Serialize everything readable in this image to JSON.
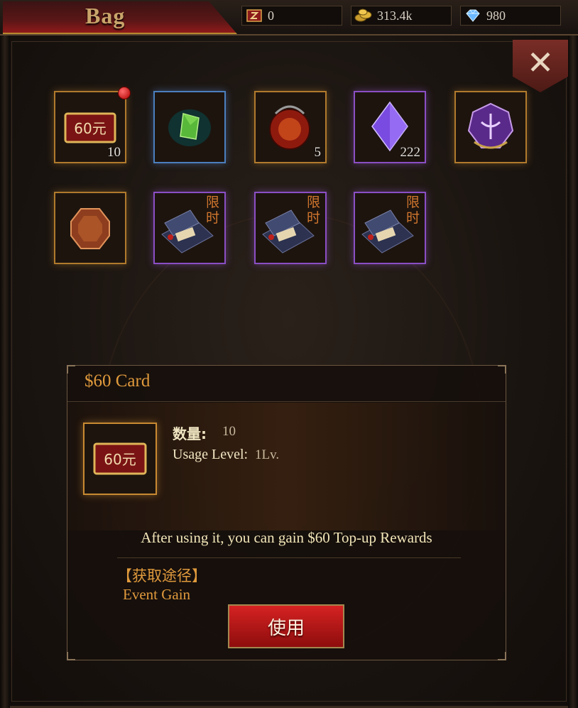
{
  "header": {
    "title": "Bag",
    "resources": [
      {
        "icon": "ticket-icon",
        "value": "0"
      },
      {
        "icon": "gold-coins-icon",
        "value": "313.4k"
      },
      {
        "icon": "diamond-icon",
        "value": "980"
      }
    ],
    "close_label": "✕"
  },
  "inventory": {
    "items": [
      {
        "name": "60-card",
        "icon": "card-60-icon",
        "card_text": "60元",
        "count": "10",
        "rarity": "orange",
        "has_alert": true
      },
      {
        "name": "green-gem",
        "icon": "green-gem-icon",
        "count": "",
        "rarity": "blue"
      },
      {
        "name": "red-amulet",
        "icon": "red-amulet-icon",
        "count": "5",
        "rarity": "orange"
      },
      {
        "name": "purple-crystal",
        "icon": "purple-crystal-icon",
        "count": "222",
        "rarity": "purple"
      },
      {
        "name": "purple-emblem",
        "icon": "purple-emblem-icon",
        "count": "",
        "rarity": "orange"
      },
      {
        "name": "orange-gem",
        "icon": "orange-gem-icon",
        "count": "",
        "rarity": "orange"
      },
      {
        "name": "limited-chest-1",
        "icon": "limited-chest-icon",
        "limited_label": "限时",
        "rarity": "purple"
      },
      {
        "name": "limited-chest-2",
        "icon": "limited-chest-icon",
        "limited_label": "限时",
        "rarity": "purple"
      },
      {
        "name": "limited-chest-3",
        "icon": "limited-chest-icon",
        "limited_label": "限时",
        "rarity": "purple"
      }
    ]
  },
  "detail": {
    "title": "$60 Card",
    "card_text": "60元",
    "quantity_label": "数量:",
    "quantity_value": "10",
    "level_label": "Usage Level:",
    "level_value": "1Lv.",
    "description": "After using it, you can gain $60 Top-up Rewards",
    "source_heading": "【获取途径】",
    "source_value": "Event Gain",
    "use_button": "使用"
  },
  "colors": {
    "accent_orange": "#e09a3c",
    "button_red": "#d62222",
    "rarity_orange": "#b07a2c",
    "rarity_blue": "#4b7fbd",
    "rarity_purple": "#8a4fc4"
  }
}
